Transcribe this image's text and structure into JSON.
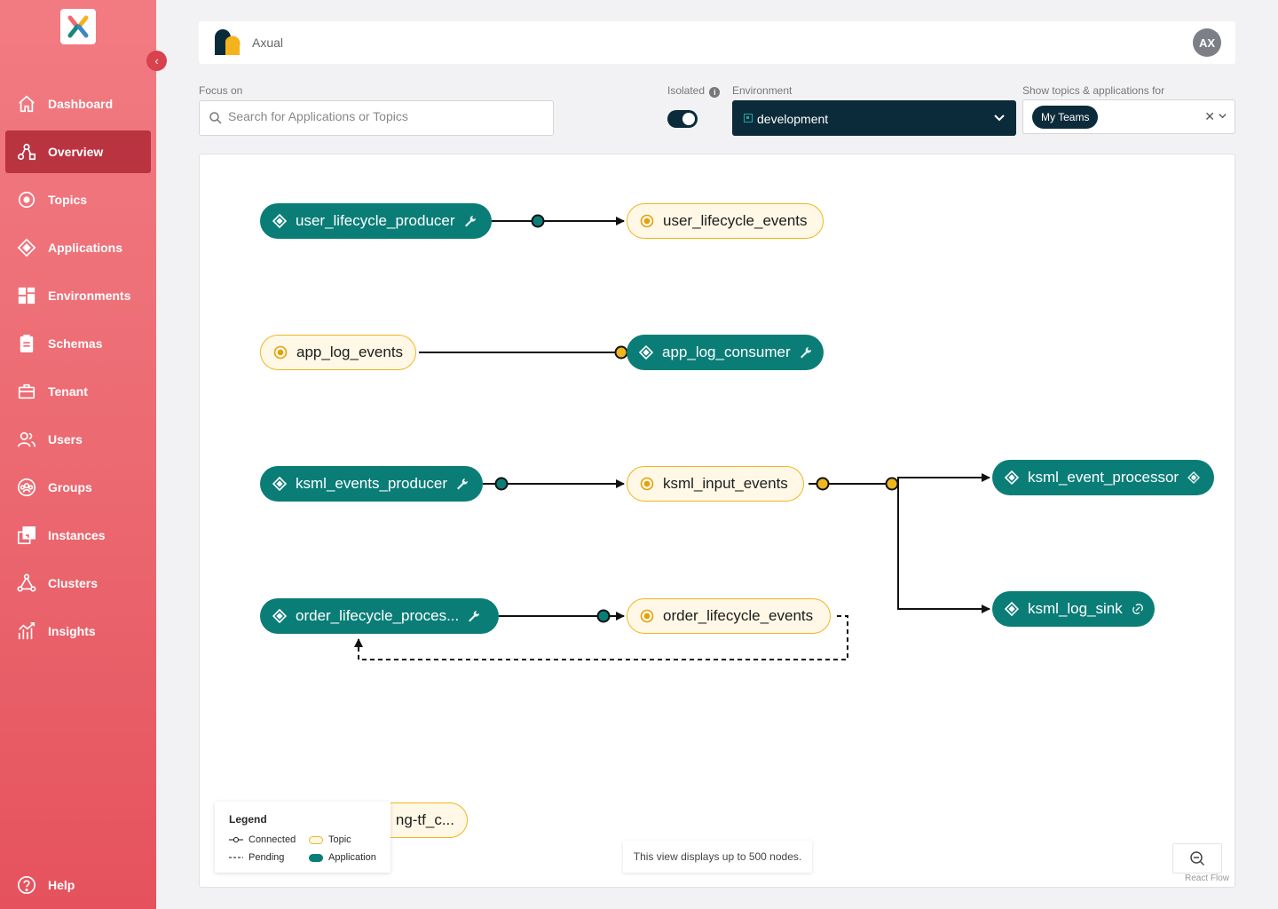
{
  "sidebar": {
    "collapse_icon": "chevron-left-icon",
    "items": [
      {
        "label": "Dashboard",
        "icon": "home-icon"
      },
      {
        "label": "Overview",
        "icon": "overview-icon"
      },
      {
        "label": "Topics",
        "icon": "topic-icon"
      },
      {
        "label": "Applications",
        "icon": "application-icon"
      },
      {
        "label": "Environments",
        "icon": "grid-icon"
      },
      {
        "label": "Schemas",
        "icon": "clipboard-icon"
      },
      {
        "label": "Tenant",
        "icon": "briefcase-icon"
      },
      {
        "label": "Users",
        "icon": "users-icon"
      },
      {
        "label": "Groups",
        "icon": "groups-icon"
      },
      {
        "label": "Instances",
        "icon": "instances-icon"
      },
      {
        "label": "Clusters",
        "icon": "clusters-icon"
      },
      {
        "label": "Insights",
        "icon": "insights-icon"
      }
    ],
    "active": "Overview",
    "help": {
      "label": "Help",
      "icon": "help-icon"
    }
  },
  "header": {
    "org_name": "Axual",
    "avatar_initials": "AX"
  },
  "filters": {
    "focus_label": "Focus on",
    "search_placeholder": "Search for Applications or Topics",
    "isolated_label": "Isolated",
    "isolated_on": true,
    "environment_label": "Environment",
    "environment_value": "development",
    "show_for_label": "Show topics & applications for",
    "show_for_chip": "My Teams",
    "clear_symbol": "✕"
  },
  "graph": {
    "nodes": {
      "user_lifecycle_producer": {
        "label": "user_lifecycle_producer",
        "kind": "application"
      },
      "user_lifecycle_events": {
        "label": "user_lifecycle_events",
        "kind": "topic"
      },
      "app_log_events": {
        "label": "app_log_events",
        "kind": "topic"
      },
      "app_log_consumer": {
        "label": "app_log_consumer",
        "kind": "application"
      },
      "ksml_events_producer": {
        "label": "ksml_events_producer",
        "kind": "application"
      },
      "ksml_input_events": {
        "label": "ksml_input_events",
        "kind": "topic"
      },
      "ksml_event_processor": {
        "label": "ksml_event_processor",
        "kind": "application"
      },
      "ksml_log_sink": {
        "label": "ksml_log_sink",
        "kind": "application"
      },
      "order_lifecycle_proces": {
        "label": "order_lifecycle_proces...",
        "kind": "application"
      },
      "order_lifecycle_events": {
        "label": "order_lifecycle_events",
        "kind": "topic"
      },
      "partial_topic": {
        "label": "ng-tf_c...",
        "kind": "topic"
      }
    },
    "edges": [
      {
        "from": "user_lifecycle_producer",
        "to": "user_lifecycle_events",
        "status": "connected"
      },
      {
        "from": "app_log_events",
        "to": "app_log_consumer",
        "status": "connected"
      },
      {
        "from": "ksml_events_producer",
        "to": "ksml_input_events",
        "status": "connected"
      },
      {
        "from": "ksml_input_events",
        "to": "ksml_event_processor",
        "status": "connected"
      },
      {
        "from": "ksml_input_events",
        "to": "ksml_log_sink",
        "status": "connected"
      },
      {
        "from": "order_lifecycle_proces",
        "to": "order_lifecycle_events",
        "status": "connected"
      },
      {
        "from": "order_lifecycle_events",
        "to": "order_lifecycle_proces",
        "status": "pending"
      }
    ]
  },
  "legend": {
    "title": "Legend",
    "connected": "Connected",
    "pending": "Pending",
    "topic": "Topic",
    "application": "Application"
  },
  "note": "This view displays up to 500 nodes.",
  "attribution": "React Flow",
  "colors": {
    "sidebar_top": "#f27b82",
    "sidebar_active": "#b93440",
    "application": "#0b7d77",
    "topic_border": "#f0b620",
    "topic_fill": "#fff8e6",
    "dark_navy": "#0c2b3a"
  }
}
